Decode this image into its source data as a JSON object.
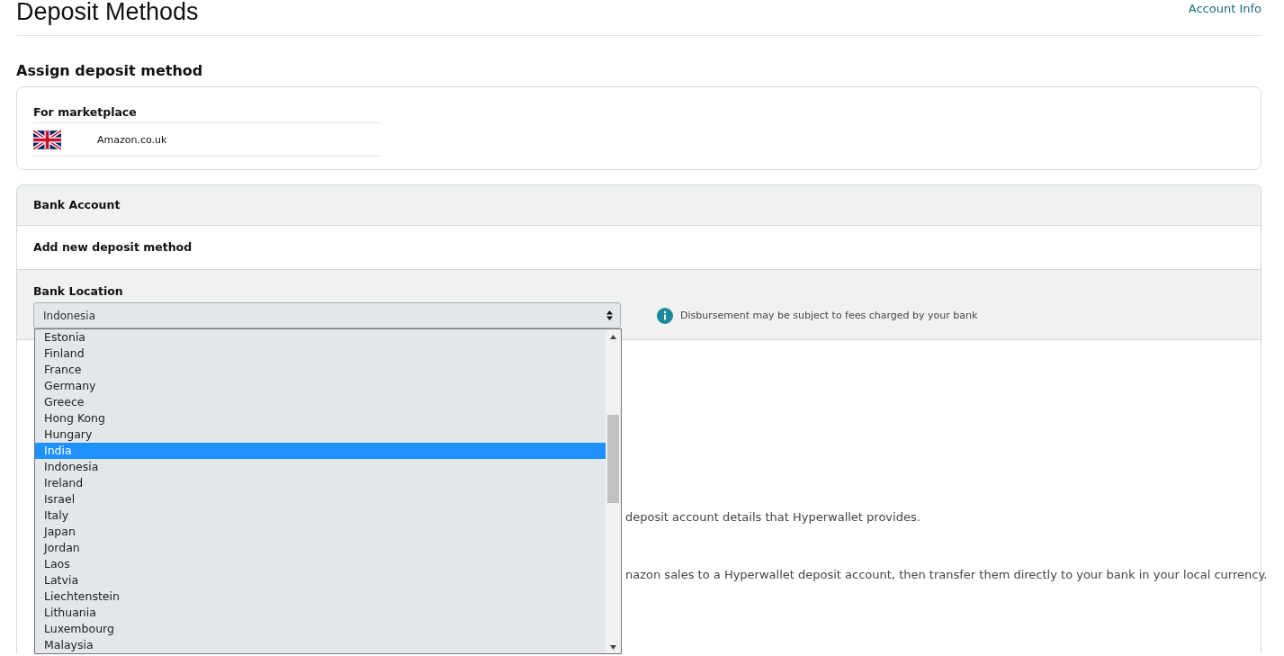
{
  "page": {
    "title": "Deposit Methods",
    "account_link": "Account Info"
  },
  "assign": {
    "heading": "Assign deposit method",
    "marketplace_label": "For marketplace",
    "marketplace": "Amazon.co.uk"
  },
  "bank": {
    "header": "Bank Account",
    "add_new": "Add new deposit method",
    "location_label": "Bank Location",
    "location_value": "Indonesia",
    "info_note": "Disbursement may be subject to fees charged by your bank"
  },
  "background_texts": [
    "deposit account details that Hyperwallet provides.",
    "nazon sales to a Hyperwallet deposit account, then transfer them directly to your bank in your local currency."
  ],
  "dropdown_options": [
    {
      "label": "Estonia",
      "selected": false
    },
    {
      "label": "Finland",
      "selected": false
    },
    {
      "label": "France",
      "selected": false
    },
    {
      "label": "Germany",
      "selected": false
    },
    {
      "label": "Greece",
      "selected": false
    },
    {
      "label": "Hong Kong",
      "selected": false
    },
    {
      "label": "Hungary",
      "selected": false
    },
    {
      "label": "India",
      "selected": true
    },
    {
      "label": "Indonesia",
      "selected": false
    },
    {
      "label": "Ireland",
      "selected": false
    },
    {
      "label": "Israel",
      "selected": false
    },
    {
      "label": "Italy",
      "selected": false
    },
    {
      "label": "Japan",
      "selected": false
    },
    {
      "label": "Jordan",
      "selected": false
    },
    {
      "label": "Laos",
      "selected": false
    },
    {
      "label": "Latvia",
      "selected": false
    },
    {
      "label": "Liechtenstein",
      "selected": false
    },
    {
      "label": "Lithuania",
      "selected": false
    },
    {
      "label": "Luxembourg",
      "selected": false
    },
    {
      "label": "Malaysia",
      "selected": false
    }
  ]
}
